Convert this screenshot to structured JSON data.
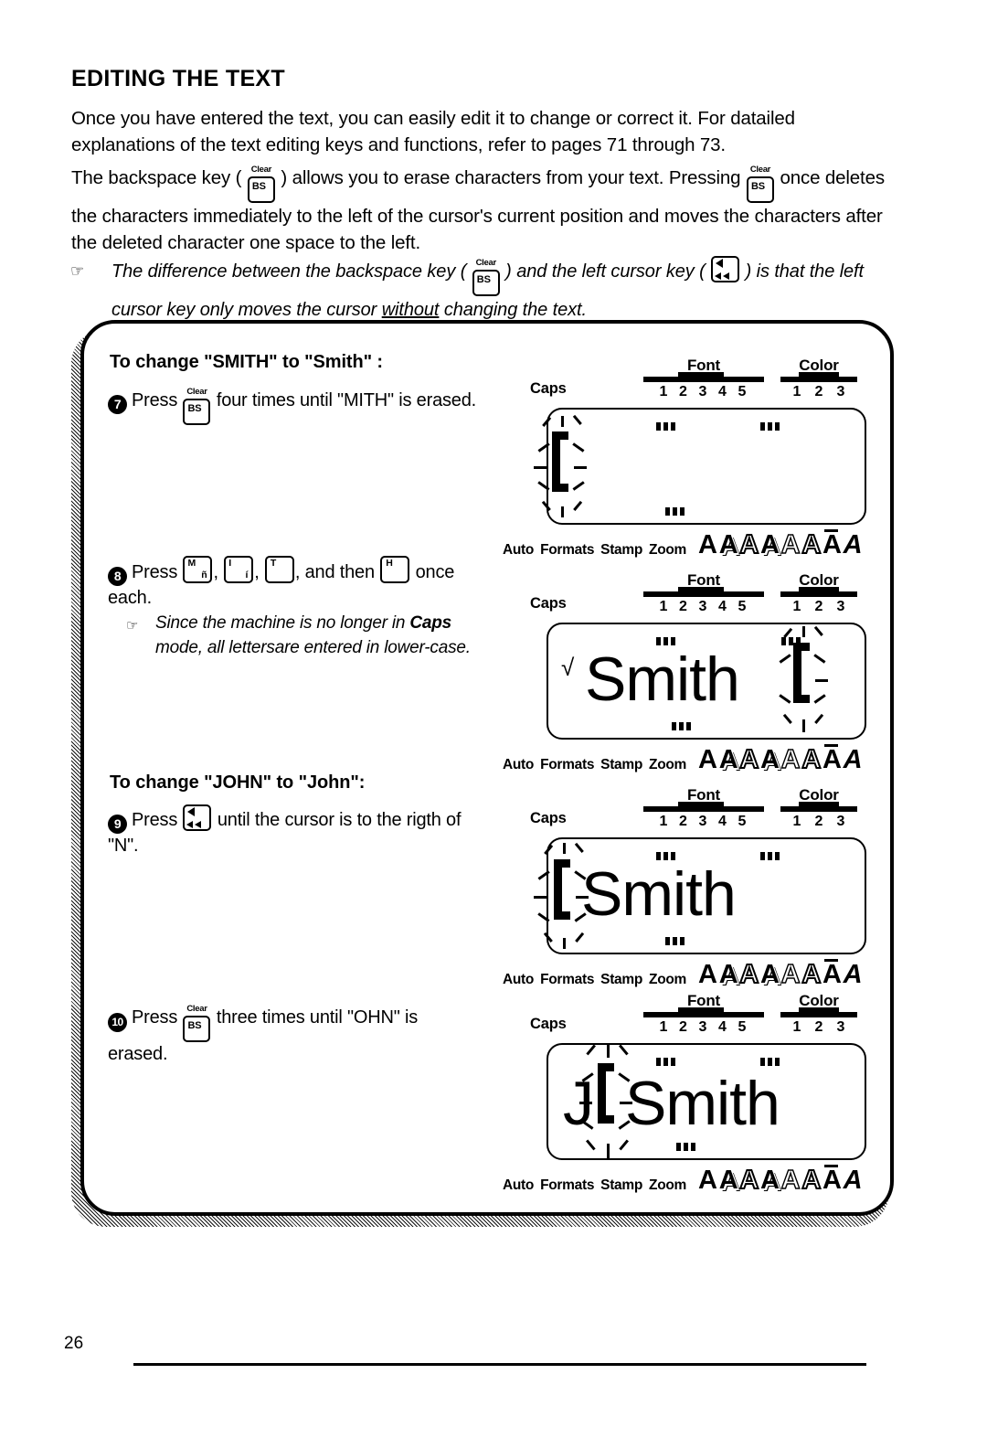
{
  "document": {
    "section_title": "EDITING THE TEXT",
    "page_number": "26"
  },
  "body": {
    "paragraph_1": "Once you have entered the text, you can easily edit it to change or correct it.  For datailed explanations of the text editing keys and functions, refer to pages 71 through 73.",
    "paragraph_2_part1": "The backspace key ( ",
    "paragraph_2_part2": " ) allows you to erase characters from your text.  Pressing ",
    "paragraph_2_part3": " once deletes the characters immediately to the left of the cursor's current position and moves the characters after the deleted character one space to the left.",
    "note_part1": "The difference between the backspace key ( ",
    "note_part2": " ) and the left cursor key ( ",
    "note_part3": " ) is that the left cursor key only moves the cursor ",
    "note_underlined": "without",
    "note_part4": " changing the text."
  },
  "keys": {
    "backspace": {
      "face": "BS",
      "top_label": "Clear",
      "name": "backspace-clear-key"
    },
    "left_cursor": {
      "name": "left-cursor-key"
    },
    "m": {
      "face": "M",
      "secondary": "ñ"
    },
    "i": {
      "face": "I",
      "secondary": "í"
    },
    "t": {
      "face": "T"
    },
    "h": {
      "face": "H"
    }
  },
  "instructions": {
    "group_1": {
      "title": "To change \"SMITH\" to \"Smith\" :",
      "steps": [
        {
          "number": "7",
          "text_before": "Press",
          "text_after": "four times until \"MITH\" is erased."
        },
        {
          "number": "8",
          "text_before": "Press",
          "text_middle_1": ",",
          "text_middle_2": ",",
          "text_middle_3": ", and then",
          "text_after": "once each.",
          "note": "Since the machine is no longer in ",
          "note_bold": "Caps",
          "note_rest": " mode, all lettersare entered in lower-case."
        }
      ]
    },
    "group_2": {
      "title": "To change \"JOHN\" to \"John\":",
      "steps": [
        {
          "number": "9",
          "text_before": "Press",
          "text_after": "until the cursor is to the rigth of \"N\"."
        },
        {
          "number": "10",
          "text_before": "Press",
          "text_after": "three times until \"OHN\" is erased."
        }
      ]
    }
  },
  "lcd_displays": [
    {
      "id": "display-1",
      "caps_label": "Caps",
      "font_scale": {
        "label": "Font",
        "ticks": [
          "1",
          "2",
          "3",
          "4",
          "5"
        ]
      },
      "color_scale": {
        "label": "Color",
        "ticks": [
          "1",
          "2",
          "3"
        ]
      },
      "screen_text": "",
      "cursor_position": "start",
      "caps_indicator_on": true,
      "bottom_indicators": [
        "Auto",
        "Formats",
        "Stamp",
        "Zoom"
      ],
      "style_glyphs": [
        "A",
        "A",
        "A",
        "A",
        "A",
        "A",
        "A",
        "A"
      ]
    },
    {
      "id": "display-2",
      "caps_label": "Caps",
      "font_scale": {
        "label": "Font",
        "ticks": [
          "1",
          "2",
          "3",
          "4",
          "5"
        ]
      },
      "color_scale": {
        "label": "Color",
        "ticks": [
          "1",
          "2",
          "3"
        ]
      },
      "screen_text": "Smith",
      "cursor_position": "end",
      "caps_indicator_on": false,
      "bottom_indicators": [
        "Auto",
        "Formats",
        "Stamp",
        "Zoom"
      ],
      "style_glyphs": [
        "A",
        "A",
        "A",
        "A",
        "A",
        "A",
        "A",
        "A"
      ]
    },
    {
      "id": "display-3",
      "caps_label": "Caps",
      "font_scale": {
        "label": "Font",
        "ticks": [
          "1",
          "2",
          "3",
          "4",
          "5"
        ]
      },
      "color_scale": {
        "label": "Color",
        "ticks": [
          "1",
          "2",
          "3"
        ]
      },
      "screen_text": "Smith",
      "cursor_position": "start",
      "caps_indicator_on": true,
      "bottom_indicators": [
        "Auto",
        "Formats",
        "Stamp",
        "Zoom"
      ],
      "style_glyphs": [
        "A",
        "A",
        "A",
        "A",
        "A",
        "A",
        "A",
        "A"
      ]
    },
    {
      "id": "display-4",
      "caps_label": "Caps",
      "font_scale": {
        "label": "Font",
        "ticks": [
          "1",
          "2",
          "3",
          "4",
          "5"
        ]
      },
      "color_scale": {
        "label": "Color",
        "ticks": [
          "1",
          "2",
          "3"
        ]
      },
      "screen_text_pre": "J",
      "screen_text": "Smith",
      "cursor_position": "after-J",
      "caps_indicator_on": false,
      "bottom_indicators": [
        "Auto",
        "Formats",
        "Stamp",
        "Zoom"
      ],
      "style_glyphs": [
        "A",
        "A",
        "A",
        "A",
        "A",
        "A",
        "A",
        "A"
      ]
    }
  ],
  "colors": {
    "ink": "#000000",
    "paper": "#ffffff"
  }
}
